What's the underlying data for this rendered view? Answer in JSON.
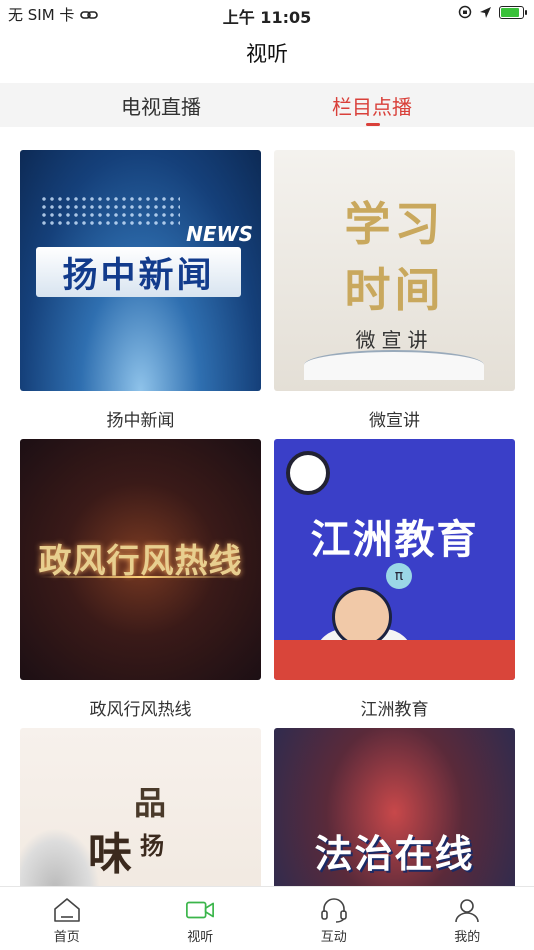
{
  "status_bar": {
    "carrier": "无 SIM 卡",
    "time": "上午 11:05",
    "battery_level": 0.85,
    "battery_color": "#3ac13a"
  },
  "nav": {
    "title": "视听"
  },
  "tabs": [
    {
      "label": "电视直播",
      "active": false
    },
    {
      "label": "栏目点播",
      "active": true
    }
  ],
  "accent_color": "#d9403a",
  "programs": [
    {
      "name": "扬中新闻",
      "thumb_text": "扬中新闻",
      "thumb_extra": "NEWS"
    },
    {
      "name": "微宣讲",
      "thumb_text_1": "学习",
      "thumb_text_2": "时间",
      "thumb_sub": "微宣讲"
    },
    {
      "name": "政风行风热线",
      "thumb_text": "政风行风热线"
    },
    {
      "name": "江洲教育",
      "thumb_text": "江洲教育",
      "thumb_extra": "π"
    },
    {
      "name": "",
      "thumb_c1": "味",
      "thumb_c2": "品",
      "thumb_c3": "扬"
    },
    {
      "name": "",
      "thumb_text": "法治在线"
    }
  ],
  "bottom_nav": [
    {
      "label": "首页",
      "icon": "home-icon"
    },
    {
      "label": "视听",
      "icon": "video-camera-icon",
      "active": true
    },
    {
      "label": "互动",
      "icon": "headset-icon"
    },
    {
      "label": "我的",
      "icon": "user-icon"
    }
  ]
}
